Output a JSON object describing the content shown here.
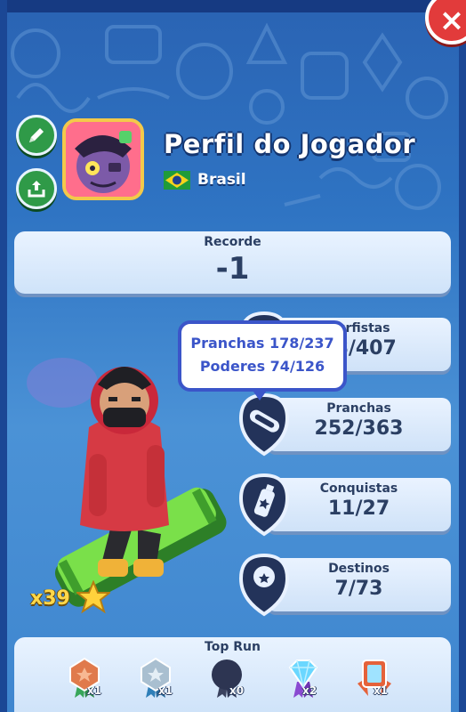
{
  "header": {
    "title": "Perfil do Jogador",
    "country": "Brasil",
    "flag_colors": {
      "green": "#1f9b3a",
      "yellow": "#f5d21c",
      "blue": "#1e3f8f"
    }
  },
  "close_button": {
    "label": "×"
  },
  "record": {
    "label": "Recorde",
    "value": "-1"
  },
  "tooltip": {
    "line1": "Pranchas 178/237",
    "line2": "Poderes 74/126"
  },
  "stats": [
    {
      "label": "Surfistas",
      "value": "48/407",
      "icon": "surfer-icon"
    },
    {
      "label": "Pranchas",
      "value": "252/363",
      "icon": "hoverboard-icon"
    },
    {
      "label": "Conquistas",
      "value": "11/27",
      "icon": "spray-can-icon"
    },
    {
      "label": "Destinos",
      "value": "7/73",
      "icon": "map-pin-icon"
    }
  ],
  "character": {
    "multiplier": "x39",
    "icon": "star-icon"
  },
  "top_run": {
    "label": "Top Run",
    "medals": [
      {
        "name": "bronze-medal-icon",
        "count": "x1",
        "color": "#e07a4c"
      },
      {
        "name": "silver-medal-icon",
        "count": "x1",
        "color": "#a9bfd0"
      },
      {
        "name": "locked-medal-icon",
        "count": "x0",
        "color": "#2d3552"
      },
      {
        "name": "diamond-medal-icon",
        "count": "x2",
        "color": "#6ad7ff"
      },
      {
        "name": "crystal-shield-icon",
        "count": "x1",
        "color": "#e5623a"
      }
    ]
  },
  "colors": {
    "panel": "#dcebfb",
    "text": "#2b3f63",
    "accent": "#3b55c9",
    "green_button": "#2f9a48",
    "close": "#e23b3b"
  }
}
